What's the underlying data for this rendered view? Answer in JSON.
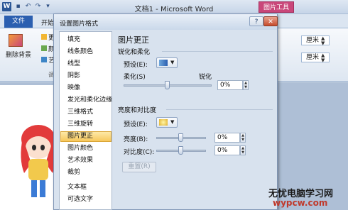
{
  "app": {
    "logo": "W",
    "title": "文档1 - Microsoft Word",
    "context_tab": "图片工具",
    "tabs": [
      "文件",
      "开始"
    ],
    "ribbon": {
      "remove_bg_label": "删除背景",
      "small_items": [
        "更",
        "颜",
        "艺"
      ],
      "group_label": "调整"
    },
    "right_fields": [
      {
        "value": "厘米"
      },
      {
        "value": "厘米"
      }
    ]
  },
  "dialog": {
    "title": "设置图片格式",
    "help_label": "?",
    "close_label": "✕",
    "nav": {
      "items": [
        "填充",
        "线条颜色",
        "线型",
        "阴影",
        "映像",
        "发光和柔化边缘",
        "三维格式",
        "三维旋转",
        "图片更正",
        "图片颜色",
        "艺术效果",
        "裁剪",
        "文本框",
        "可选文字"
      ],
      "selected": "图片更正"
    },
    "panel": {
      "title": "图片更正",
      "sharpen_group": "锐化和柔化",
      "preset_label": "预设(E):",
      "soften_label": "柔化(S)",
      "sharpen_label": "锐化",
      "sharpen_value": "0%",
      "sharpen_level": 0.5,
      "bc_group": "亮度和对比度",
      "bc_preset_label": "预设(E):",
      "brightness_label": "亮度(B):",
      "brightness_value": "0%",
      "brightness_level": 0.5,
      "contrast_label": "对比度(C):",
      "contrast_value": "0%",
      "contrast_level": 0.5,
      "reset_label": "重置(R)"
    }
  },
  "watermark": {
    "title": "无忧电脑学习网",
    "url": "wypcw.com"
  },
  "colors": {
    "accent": "#2b5fb0",
    "context_tab": "#c9477a",
    "nav_selected": "#f7c75b"
  }
}
